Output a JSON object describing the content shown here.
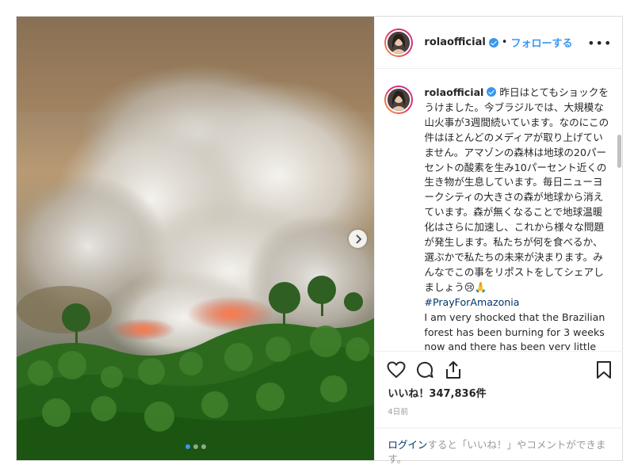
{
  "post": {
    "username": "rolaofficial",
    "separator": "•",
    "follow_label": "フォローする",
    "more_label": "•••",
    "caption_jp": "昨日はとてもショックをうけました。今ブラジルでは、大規模な山火事が3週間続いています。なのにこの件はほとんどのメディアが取り上げていません。アマゾンの森林は地球の20パーセントの酸素を生み10パーセント近くの生き物が生息しています。毎日ニューヨークシティの大きさの森が地球から消えています。森が無くなることで地球温暖化はさらに加速し、これから様々な問題が発生します。私たちが何を食べるか、選ぶかで私たちの未来が決まります。みんなでこの事をリポストをしてシェアしましょう😢🙏",
    "hashtag": "#PrayForAmazonia",
    "caption_en": "I am very shocked that the Brazilian forest has been burning for 3 weeks now and there has been very little media coverage on this devastation."
  },
  "engagement": {
    "likes_text": "いいね！347,836件",
    "time_ago": "4日前"
  },
  "login_prompt": {
    "link_text": "ログイン",
    "rest_text": "すると「いいね！」やコメントができます。"
  },
  "carousel": {
    "slide_count": 3,
    "active_index": 0
  },
  "icons": {
    "like": "heart-icon",
    "comment": "comment-icon",
    "share": "share-icon",
    "save": "bookmark-icon",
    "next": "chevron-right-icon",
    "verified": "verified-badge-icon"
  },
  "colors": {
    "link_blue": "#3897f0",
    "hashtag_navy": "#003569",
    "border": "#dbdbdb",
    "muted_text": "#999999"
  }
}
